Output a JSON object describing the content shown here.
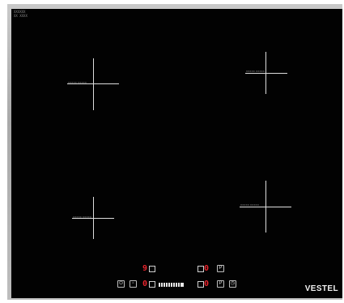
{
  "corner_label": "XXXXXX\nXX XXXX",
  "burners": [
    {
      "id": "rear-left",
      "label": "XXXXX XXXXX"
    },
    {
      "id": "rear-right",
      "label": "XXXXX XXXXX"
    },
    {
      "id": "front-left",
      "label": "XXXXX XXXXX"
    },
    {
      "id": "front-right",
      "label": "XXXXX XXXXX"
    }
  ],
  "controls": {
    "top_display_left": "9",
    "top_display_right": "0",
    "bottom_display_left": "0",
    "bottom_display_right": "0",
    "button_power_icon": "power-icon",
    "button_lock_icon": "lock-icon",
    "button_p_top": "P",
    "button_p_bottom": "P",
    "button_timer_icon": "timer-icon",
    "slider_segments": 10
  },
  "brand": "VESTEL",
  "colors": {
    "glass": "#020202",
    "frame": "#b8b8b8",
    "display_red": "#e8242c",
    "marking": "#dcdcdc"
  }
}
